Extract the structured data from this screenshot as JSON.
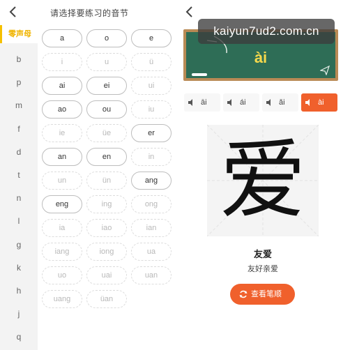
{
  "left": {
    "title": "请选择要练习的音节",
    "nav": [
      "零声母",
      "b",
      "p",
      "m",
      "f",
      "d",
      "t",
      "n",
      "l",
      "g",
      "k",
      "h",
      "j",
      "q"
    ],
    "syllables": [
      {
        "text": "a",
        "state": "solid"
      },
      {
        "text": "o",
        "state": "solid"
      },
      {
        "text": "e",
        "state": "solid"
      },
      {
        "text": "i",
        "state": "dashed"
      },
      {
        "text": "u",
        "state": "dashed"
      },
      {
        "text": "ü",
        "state": "dashed"
      },
      {
        "text": "ai",
        "state": "solid"
      },
      {
        "text": "ei",
        "state": "solid"
      },
      {
        "text": "ui",
        "state": "dashed"
      },
      {
        "text": "ao",
        "state": "solid"
      },
      {
        "text": "ou",
        "state": "solid"
      },
      {
        "text": "iu",
        "state": "dashed"
      },
      {
        "text": "ie",
        "state": "dashed"
      },
      {
        "text": "üe",
        "state": "dashed"
      },
      {
        "text": "er",
        "state": "solid"
      },
      {
        "text": "an",
        "state": "solid"
      },
      {
        "text": "en",
        "state": "solid"
      },
      {
        "text": "in",
        "state": "dashed"
      },
      {
        "text": "un",
        "state": "dashed"
      },
      {
        "text": "ün",
        "state": "dashed"
      },
      {
        "text": "ang",
        "state": "solid"
      },
      {
        "text": "eng",
        "state": "solid"
      },
      {
        "text": "ing",
        "state": "dashed"
      },
      {
        "text": "ong",
        "state": "dashed"
      },
      {
        "text": "ia",
        "state": "dashed"
      },
      {
        "text": "iao",
        "state": "dashed"
      },
      {
        "text": "ian",
        "state": "dashed"
      },
      {
        "text": "iang",
        "state": "dashed"
      },
      {
        "text": "iong",
        "state": "dashed"
      },
      {
        "text": "ua",
        "state": "dashed"
      },
      {
        "text": "uo",
        "state": "dashed"
      },
      {
        "text": "uai",
        "state": "dashed"
      },
      {
        "text": "uan",
        "state": "dashed"
      },
      {
        "text": "uang",
        "state": "dashed"
      },
      {
        "text": "üan",
        "state": "dashed"
      }
    ]
  },
  "watermark": "kaiyun7ud2.com.cn",
  "board": {
    "pinyin": "ài"
  },
  "tones": [
    "āi",
    "ái",
    "ǎi",
    "ài"
  ],
  "character": "爱",
  "word": "友爱",
  "phrase": "友好亲爱",
  "stroke_button": "查看笔顺",
  "colors": {
    "accent": "#f0602c",
    "nav_active": "#f0b400",
    "board": "#2e6d56",
    "board_frame": "#b98a55",
    "board_text": "#f7d94c"
  }
}
